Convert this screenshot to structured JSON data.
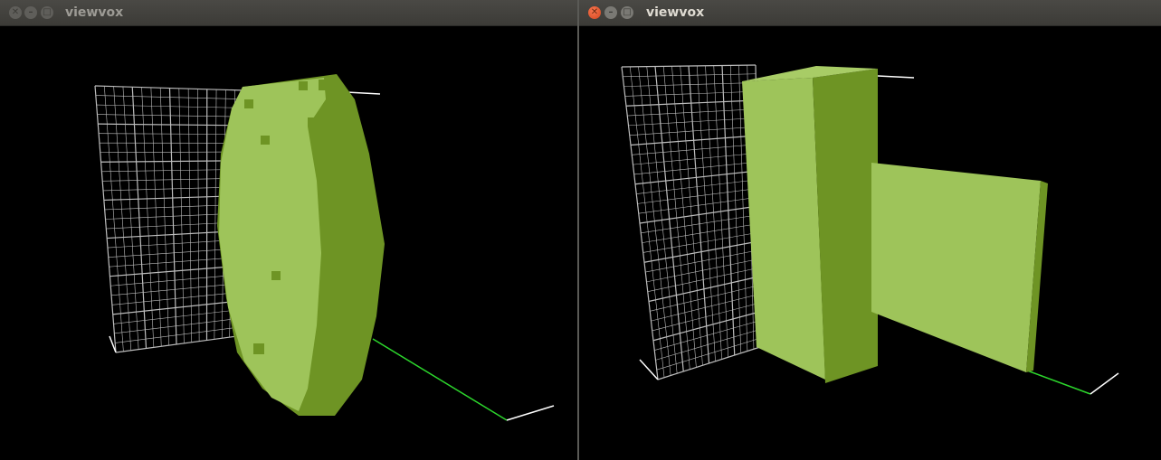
{
  "windows": [
    {
      "title": "viewvox",
      "buttons": {
        "close_icon": "close-icon",
        "minimize_icon": "minimize-icon",
        "maximize_icon": "maximize-icon"
      },
      "scene": "voxelized-ellipsoid",
      "active": false
    },
    {
      "title": "viewvox",
      "buttons": {
        "close_icon": "close-icon",
        "minimize_icon": "minimize-icon",
        "maximize_icon": "maximize-icon"
      },
      "scene": "voxelized-boxes",
      "active": true
    }
  ],
  "colors": {
    "voxel_light": "#9ec45a",
    "voxel_dark": "#6e9424",
    "grid": "#bdbdbd",
    "axis_x": "#ffffff",
    "axis_z": "#2cd62c",
    "background": "#000000"
  }
}
